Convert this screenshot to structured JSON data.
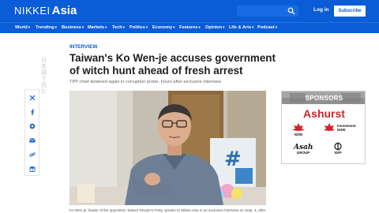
{
  "header": {
    "logo_part1": "NIKKEI",
    "logo_part2": "Asia",
    "login_label": "Log in",
    "subscribe_label": "Subscribe",
    "search_icon": "search-icon"
  },
  "nav": {
    "items": [
      "World",
      "Trending",
      "Business",
      "Markets",
      "Tech",
      "Politics",
      "Economy",
      "Features",
      "Opinion",
      "Life & Arts",
      "Podcast"
    ],
    "chevron": "▾"
  },
  "vertical_text": "日本語で読む",
  "share_icons": [
    "x-icon",
    "facebook-icon",
    "whatsapp-icon",
    "email-icon",
    "link-icon",
    "gift-icon"
  ],
  "article": {
    "kicker": "INTERVIEW",
    "headline": "Taiwan's Ko Wen-je accuses government of witch hunt ahead of fresh arrest",
    "subhead": "TPP chief detained again in corruption probe, hours after exclusive interview",
    "caption": "Ko Wen-je, leader of the opposition Taiwan People's Party, speaks to Nikkei Asia in an exclusive interview on Sept. 4, after he was"
  },
  "sponsors": {
    "title": "SPONSORS",
    "main": "Ashurst",
    "logos": [
      {
        "name": "NSW",
        "label": "NSW"
      },
      {
        "name": "Investment NSW",
        "label": "Investment NSW"
      },
      {
        "name": "Asahi",
        "label": "GROUP"
      },
      {
        "name": "IGPI",
        "label": "IGPI"
      }
    ]
  },
  "colors": {
    "brand_blue": "#0a5cd7",
    "sponsor_red": "#d0242a",
    "sponsor_gray": "#9a9a9a"
  }
}
